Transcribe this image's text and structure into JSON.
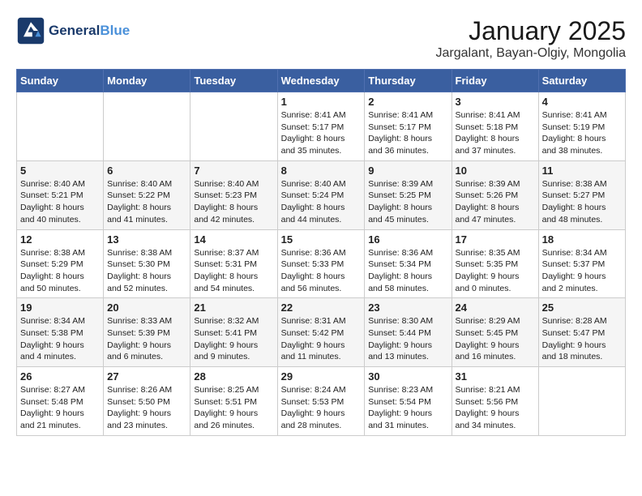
{
  "header": {
    "logo_line1": "General",
    "logo_line2": "Blue",
    "title": "January 2025",
    "subtitle": "Jargalant, Bayan-Olgiy, Mongolia"
  },
  "weekdays": [
    "Sunday",
    "Monday",
    "Tuesday",
    "Wednesday",
    "Thursday",
    "Friday",
    "Saturday"
  ],
  "weeks": [
    [
      {
        "day": null
      },
      {
        "day": null
      },
      {
        "day": null
      },
      {
        "day": 1,
        "sunrise": "8:41 AM",
        "sunset": "5:17 PM",
        "daylight": "8 hours and 35 minutes."
      },
      {
        "day": 2,
        "sunrise": "8:41 AM",
        "sunset": "5:17 PM",
        "daylight": "8 hours and 36 minutes."
      },
      {
        "day": 3,
        "sunrise": "8:41 AM",
        "sunset": "5:18 PM",
        "daylight": "8 hours and 37 minutes."
      },
      {
        "day": 4,
        "sunrise": "8:41 AM",
        "sunset": "5:19 PM",
        "daylight": "8 hours and 38 minutes."
      }
    ],
    [
      {
        "day": 5,
        "sunrise": "8:40 AM",
        "sunset": "5:21 PM",
        "daylight": "8 hours and 40 minutes."
      },
      {
        "day": 6,
        "sunrise": "8:40 AM",
        "sunset": "5:22 PM",
        "daylight": "8 hours and 41 minutes."
      },
      {
        "day": 7,
        "sunrise": "8:40 AM",
        "sunset": "5:23 PM",
        "daylight": "8 hours and 42 minutes."
      },
      {
        "day": 8,
        "sunrise": "8:40 AM",
        "sunset": "5:24 PM",
        "daylight": "8 hours and 44 minutes."
      },
      {
        "day": 9,
        "sunrise": "8:39 AM",
        "sunset": "5:25 PM",
        "daylight": "8 hours and 45 minutes."
      },
      {
        "day": 10,
        "sunrise": "8:39 AM",
        "sunset": "5:26 PM",
        "daylight": "8 hours and 47 minutes."
      },
      {
        "day": 11,
        "sunrise": "8:38 AM",
        "sunset": "5:27 PM",
        "daylight": "8 hours and 48 minutes."
      }
    ],
    [
      {
        "day": 12,
        "sunrise": "8:38 AM",
        "sunset": "5:29 PM",
        "daylight": "8 hours and 50 minutes."
      },
      {
        "day": 13,
        "sunrise": "8:38 AM",
        "sunset": "5:30 PM",
        "daylight": "8 hours and 52 minutes."
      },
      {
        "day": 14,
        "sunrise": "8:37 AM",
        "sunset": "5:31 PM",
        "daylight": "8 hours and 54 minutes."
      },
      {
        "day": 15,
        "sunrise": "8:36 AM",
        "sunset": "5:33 PM",
        "daylight": "8 hours and 56 minutes."
      },
      {
        "day": 16,
        "sunrise": "8:36 AM",
        "sunset": "5:34 PM",
        "daylight": "8 hours and 58 minutes."
      },
      {
        "day": 17,
        "sunrise": "8:35 AM",
        "sunset": "5:35 PM",
        "daylight": "9 hours and 0 minutes."
      },
      {
        "day": 18,
        "sunrise": "8:34 AM",
        "sunset": "5:37 PM",
        "daylight": "9 hours and 2 minutes."
      }
    ],
    [
      {
        "day": 19,
        "sunrise": "8:34 AM",
        "sunset": "5:38 PM",
        "daylight": "9 hours and 4 minutes."
      },
      {
        "day": 20,
        "sunrise": "8:33 AM",
        "sunset": "5:39 PM",
        "daylight": "9 hours and 6 minutes."
      },
      {
        "day": 21,
        "sunrise": "8:32 AM",
        "sunset": "5:41 PM",
        "daylight": "9 hours and 9 minutes."
      },
      {
        "day": 22,
        "sunrise": "8:31 AM",
        "sunset": "5:42 PM",
        "daylight": "9 hours and 11 minutes."
      },
      {
        "day": 23,
        "sunrise": "8:30 AM",
        "sunset": "5:44 PM",
        "daylight": "9 hours and 13 minutes."
      },
      {
        "day": 24,
        "sunrise": "8:29 AM",
        "sunset": "5:45 PM",
        "daylight": "9 hours and 16 minutes."
      },
      {
        "day": 25,
        "sunrise": "8:28 AM",
        "sunset": "5:47 PM",
        "daylight": "9 hours and 18 minutes."
      }
    ],
    [
      {
        "day": 26,
        "sunrise": "8:27 AM",
        "sunset": "5:48 PM",
        "daylight": "9 hours and 21 minutes."
      },
      {
        "day": 27,
        "sunrise": "8:26 AM",
        "sunset": "5:50 PM",
        "daylight": "9 hours and 23 minutes."
      },
      {
        "day": 28,
        "sunrise": "8:25 AM",
        "sunset": "5:51 PM",
        "daylight": "9 hours and 26 minutes."
      },
      {
        "day": 29,
        "sunrise": "8:24 AM",
        "sunset": "5:53 PM",
        "daylight": "9 hours and 28 minutes."
      },
      {
        "day": 30,
        "sunrise": "8:23 AM",
        "sunset": "5:54 PM",
        "daylight": "9 hours and 31 minutes."
      },
      {
        "day": 31,
        "sunrise": "8:21 AM",
        "sunset": "5:56 PM",
        "daylight": "9 hours and 34 minutes."
      },
      {
        "day": null
      }
    ]
  ]
}
